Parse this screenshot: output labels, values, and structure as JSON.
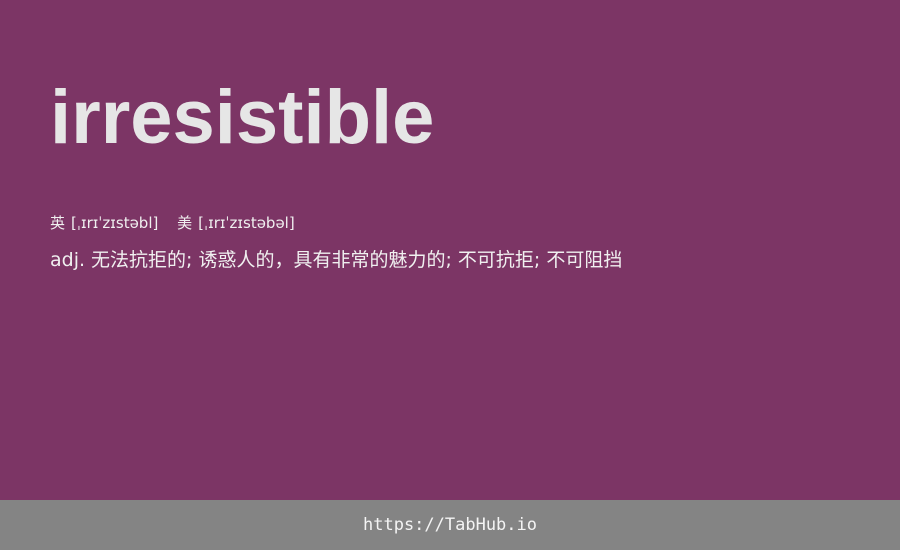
{
  "word": "irresistible",
  "phonetics": {
    "uk": {
      "label": "英",
      "text": "[ˌɪrɪˈzɪstəbl]"
    },
    "us": {
      "label": "美",
      "text": "[ˌɪrɪˈzɪstəbəl]"
    }
  },
  "definition": {
    "pos": "adj.",
    "text": "无法抗拒的; 诱惑人的，具有非常的魅力的; 不可抗拒; 不可阻挡"
  },
  "footer": {
    "link_text": "https://TabHub.io"
  },
  "colors": {
    "background": "#7c3565",
    "footer_background": "#848484",
    "word_text": "#e6e6e6",
    "body_text": "#f0f0f0"
  }
}
